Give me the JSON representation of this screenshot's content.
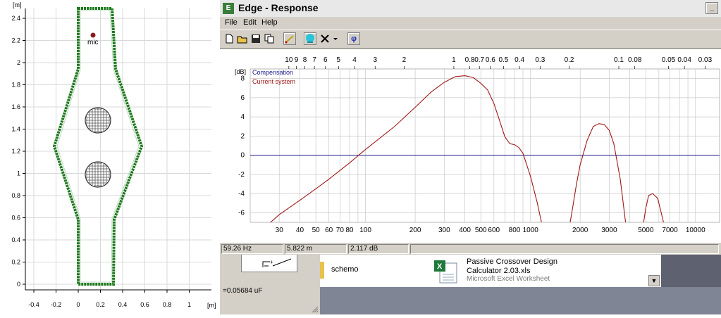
{
  "layout_view": {
    "unit_label": "[m]",
    "y_ticks": [
      "2.4",
      "2.2",
      "2",
      "1.8",
      "1.6",
      "1.4",
      "1.2",
      "1",
      "0.8",
      "0.6",
      "0.4",
      "0.2",
      "0"
    ],
    "x_ticks": [
      "-0.4",
      "-0.2",
      "0",
      "0.2",
      "0.4",
      "0.6",
      "0.8",
      "1"
    ],
    "mic_label": "mic",
    "colors": {
      "enclosure": "#1f7a1f",
      "mic": "#8b1a1a",
      "grid": "#d9d9d9"
    }
  },
  "window": {
    "title": "Edge - Response",
    "minimize_glyph": "_",
    "menu": [
      "File",
      "Edit",
      "Help"
    ],
    "toolbar_icons": [
      "new-file-icon",
      "open-folder-icon",
      "save-icon",
      "copy-icon",
      "pencil-icon",
      "sphere-icon",
      "close-x-icon",
      "dropdown-arrow-icon",
      "phi-icon"
    ],
    "phi_glyph": "φ"
  },
  "chart_data": {
    "type": "line",
    "ylabel": "[dB]",
    "ylim": [
      -7,
      9
    ],
    "y_ticks": [
      8,
      6,
      4,
      2,
      0,
      -2,
      -4,
      -6
    ],
    "x_scale": "log",
    "x_range_hz": [
      20,
      14000
    ],
    "x_ticks_bottom": [
      30,
      40,
      50,
      60,
      70,
      80,
      100,
      200,
      300,
      400,
      500,
      600,
      800,
      1000,
      2000,
      3000,
      5000,
      7000,
      10000
    ],
    "x_ticks_top": [
      "10",
      "9",
      "8",
      "7",
      "6",
      "5",
      "4",
      "3",
      "2",
      "1",
      "0.8",
      "0.7",
      "0.6",
      "0.5",
      "0.4",
      "0.3",
      "0.2",
      "0.1",
      "0.08",
      "0.05",
      "0.04",
      "0.03"
    ],
    "grid": true,
    "legend_placement": "top-left",
    "series": [
      {
        "name": "Compensation",
        "color": "#1a1a8c",
        "x": [
          20,
          14000
        ],
        "y": [
          0,
          0
        ]
      },
      {
        "name": "Current system",
        "color": "#a01818",
        "segments": [
          {
            "x": [
              20,
              25,
              30,
              40,
              50,
              60,
              80,
              100,
              150,
              200,
              250,
              300,
              350,
              400,
              450,
              500,
              550,
              600,
              650,
              700,
              750,
              800,
              850,
              900,
              1000,
              1100,
              1200
            ],
            "y": [
              -8.6,
              -7.4,
              -6.2,
              -4.7,
              -3.5,
              -2.5,
              -0.8,
              0.6,
              3.0,
              5.0,
              6.6,
              7.6,
              8.2,
              8.3,
              8.1,
              7.5,
              6.8,
              5.4,
              3.6,
              1.9,
              1.2,
              1.1,
              0.8,
              0.2,
              -2.2,
              -5.0,
              -8.0
            ]
          },
          {
            "x": [
              1700,
              1800,
              1900,
              2000,
              2200,
              2400,
              2600,
              2800,
              3000,
              3200,
              3500,
              3800
            ],
            "y": [
              -8.0,
              -5.5,
              -3.0,
              -1.0,
              1.5,
              3.0,
              3.3,
              3.2,
              2.6,
              1.2,
              -2.5,
              -7.5
            ]
          },
          {
            "x": [
              4800,
              5000,
              5200,
              5500,
              5900,
              6200,
              6500
            ],
            "y": [
              -7.5,
              -5.5,
              -4.2,
              -4.0,
              -4.5,
              -6.0,
              -7.5
            ]
          }
        ]
      }
    ]
  },
  "status": {
    "frequency": "59.26 Hz",
    "distance": "5.822 m",
    "level": "2.117 dB"
  },
  "bottom_panel": {
    "capacitance": "=0.05684 uF"
  },
  "explorer": {
    "items": [
      {
        "name": "schemo",
        "icon": "folder-icon"
      },
      {
        "name": "Passive Crossover Design Calculator 2.03.xls",
        "type": "Microsoft Excel Worksheet",
        "icon": "excel-file-icon"
      }
    ],
    "scroll_glyph": "▼"
  }
}
